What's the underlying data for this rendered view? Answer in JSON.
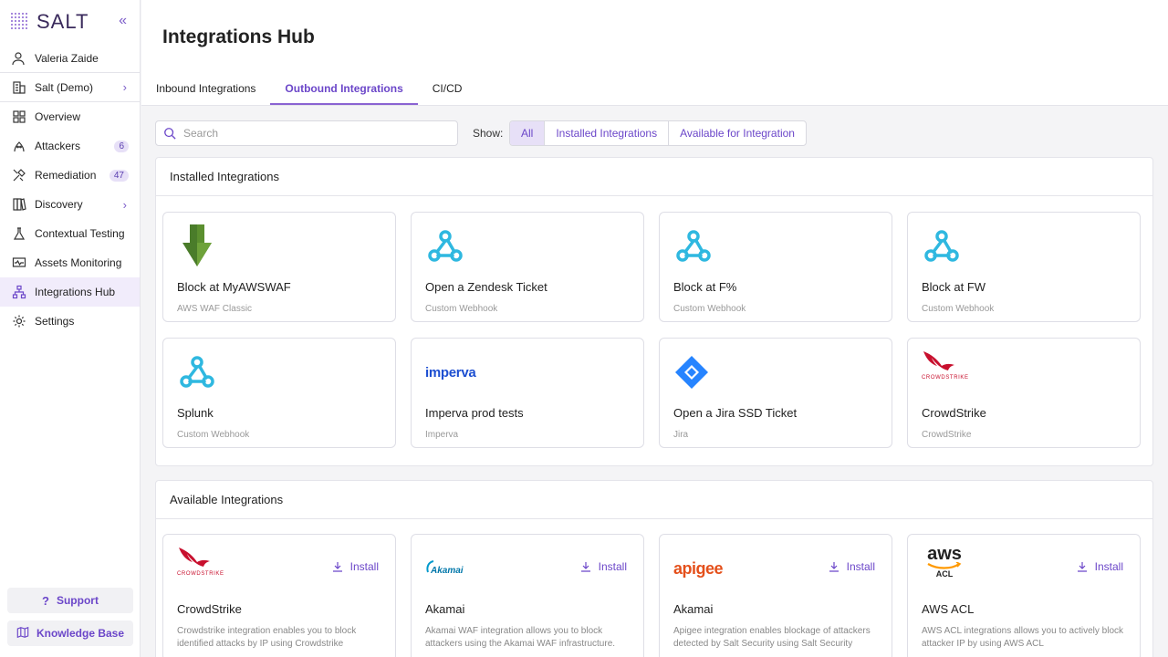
{
  "app": {
    "logo": "SALT",
    "collapse_icon": "double-chevron-left-icon"
  },
  "user": {
    "name": "Valeria Zaide"
  },
  "org": {
    "name": "Salt (Demo)"
  },
  "nav": [
    {
      "key": "overview",
      "label": "Overview",
      "icon": "grid-icon"
    },
    {
      "key": "attackers",
      "label": "Attackers",
      "icon": "hacker-icon",
      "badge": "6"
    },
    {
      "key": "remediation",
      "label": "Remediation",
      "icon": "tools-icon",
      "badge": "47"
    },
    {
      "key": "discovery",
      "label": "Discovery",
      "icon": "book-icon"
    },
    {
      "key": "contextual-testing",
      "label": "Contextual Testing",
      "icon": "flask-icon"
    },
    {
      "key": "assets-monitoring",
      "label": "Assets Monitoring",
      "icon": "monitor-icon"
    },
    {
      "key": "integrations-hub",
      "label": "Integrations Hub",
      "icon": "network-icon"
    },
    {
      "key": "settings",
      "label": "Settings",
      "icon": "gear-icon"
    }
  ],
  "sidebar_footer": {
    "support": "Support",
    "knowledge_base": "Knowledge Base"
  },
  "page": {
    "title": "Integrations Hub"
  },
  "tabs": [
    {
      "label": "Inbound Integrations",
      "active": false
    },
    {
      "label": "Outbound Integrations",
      "active": true
    },
    {
      "label": "CI/CD",
      "active": false
    }
  ],
  "search": {
    "placeholder": "Search"
  },
  "filter": {
    "label": "Show:",
    "options": [
      "All",
      "Installed Integrations",
      "Available for Integration"
    ],
    "selected": "All"
  },
  "installed": {
    "heading": "Installed Integrations",
    "cards": [
      {
        "title": "Block at MyAWSWAF",
        "type": "AWS WAF Classic",
        "logo": "aws-waf-logo"
      },
      {
        "title": "Open a Zendesk Ticket",
        "type": "Custom Webhook",
        "logo": "webhook-icon"
      },
      {
        "title": "Block at F%",
        "type": "Custom Webhook",
        "logo": "webhook-icon"
      },
      {
        "title": "Block at FW",
        "type": "Custom Webhook",
        "logo": "webhook-icon"
      },
      {
        "title": "Splunk",
        "type": "Custom Webhook",
        "logo": "webhook-icon"
      },
      {
        "title": "Imperva prod tests",
        "type": "Imperva",
        "logo": "imperva-logo",
        "logo_text": "imperva"
      },
      {
        "title": "Open a Jira SSD Ticket",
        "type": "Jira",
        "logo": "jira-logo"
      },
      {
        "title": "CrowdStrike",
        "type": "CrowdStrike",
        "logo": "crowdstrike-logo",
        "logo_text": "CROWDSTRIKE"
      }
    ]
  },
  "available": {
    "heading": "Available Integrations",
    "install_label": "Install",
    "cards": [
      {
        "title": "CrowdStrike",
        "desc": "Crowdstrike integration enables you to block identified attacks by IP using Crowdstrike",
        "logo": "crowdstrike-logo",
        "logo_text": "CROWDSTRIKE"
      },
      {
        "title": "Akamai",
        "desc": "Akamai WAF integration allows you to block attackers using the Akamai WAF infrastructure.",
        "logo": "akamai-logo",
        "logo_text": "Akamai"
      },
      {
        "title": "Akamai",
        "desc": "Apigee integration enables blockage of attackers detected by Salt Security using Salt Security",
        "logo": "apigee-logo",
        "logo_text": "apigee"
      },
      {
        "title": "AWS ACL",
        "desc": "AWS ACL integrations allows you to actively block attacker IP by using AWS ACL",
        "logo": "aws-logo",
        "logo_text": "aws",
        "logo_sub": "ACL"
      }
    ]
  },
  "colors": {
    "accent": "#6b46c9",
    "active_bg": "#f1ecfb",
    "webhook": "#2fb8e0",
    "aws_green": "#4a7c2a",
    "jira_blue": "#2684ff",
    "crowdstrike_red": "#c8102e",
    "apigee_orange": "#e4501b"
  }
}
